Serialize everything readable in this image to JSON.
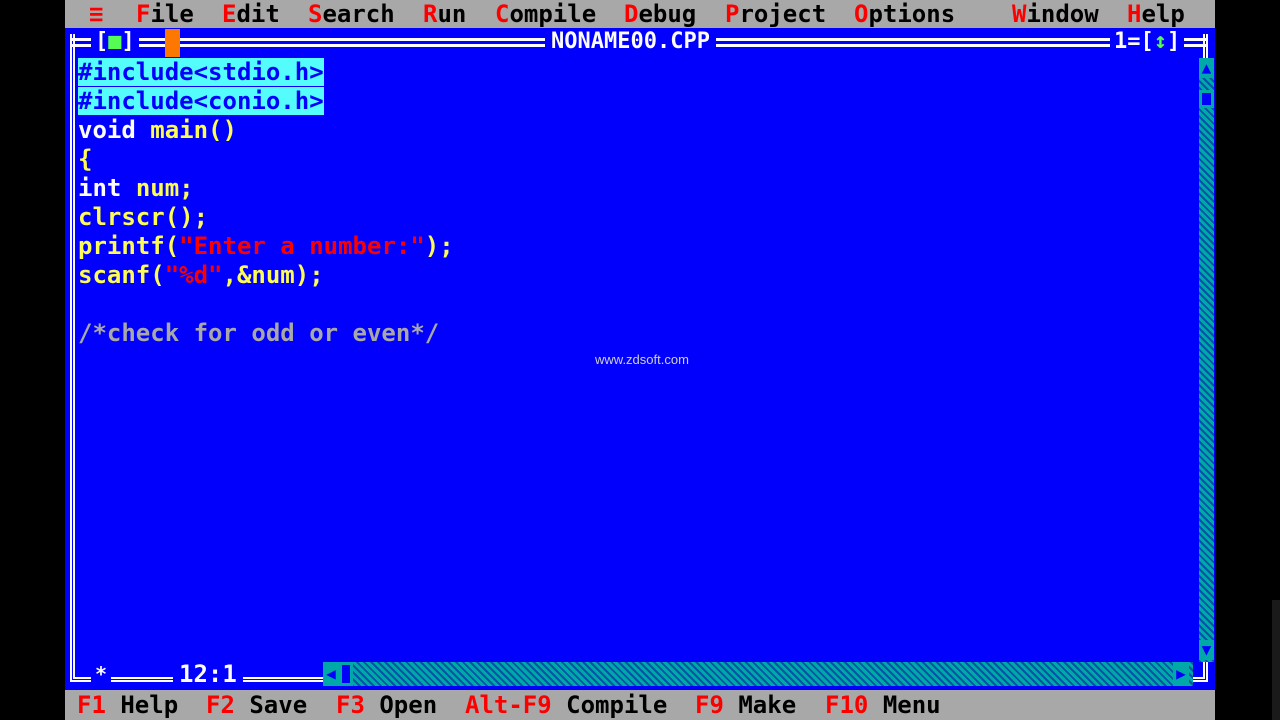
{
  "menu": {
    "system_icon": "≡",
    "items": [
      {
        "hotkey": "F",
        "rest": "ile"
      },
      {
        "hotkey": "E",
        "rest": "dit"
      },
      {
        "hotkey": "S",
        "rest": "earch"
      },
      {
        "hotkey": "R",
        "rest": "un"
      },
      {
        "hotkey": "C",
        "rest": "ompile"
      },
      {
        "hotkey": "D",
        "rest": "ebug"
      },
      {
        "hotkey": "P",
        "rest": "roject"
      },
      {
        "hotkey": "O",
        "rest": "ptions"
      },
      {
        "hotkey": "W",
        "rest": "indow"
      },
      {
        "hotkey": "H",
        "rest": "elp"
      }
    ]
  },
  "window": {
    "title": "NONAME00.CPP",
    "close_box": {
      "left": "[",
      "glyph": "■",
      "right": "]"
    },
    "zoom_box": {
      "number": "1=",
      "left": "[",
      "glyph": "↕",
      "right": "]"
    },
    "cursor_position": "12:1",
    "modified_marker": "*"
  },
  "code": {
    "include1": "#include<stdio.h>",
    "include2": "#include<conio.h>",
    "void_kw": "void",
    "main_fn": "main()",
    "open_brace": "{",
    "int_kw": "int",
    "num_decl": "num;",
    "clrscr": "clrscr();",
    "printf_fn": "printf(",
    "printf_str": "\"Enter a number:\"",
    "printf_end": ");",
    "scanf_fn": "scanf(",
    "scanf_str": "\"%d\"",
    "scanf_end": ",&num);",
    "comment": "/*check for odd or even*/"
  },
  "watermark": "www.zdsoft.com",
  "status": [
    {
      "key": "F1",
      "label": "Help"
    },
    {
      "key": "F2",
      "label": "Save"
    },
    {
      "key": "F3",
      "label": "Open"
    },
    {
      "key": "Alt-F9",
      "label": "Compile"
    },
    {
      "key": "F9",
      "label": "Make"
    },
    {
      "key": "F10",
      "label": "Menu"
    }
  ],
  "colors": {
    "editor_bg": "#0000fc",
    "menu_bg": "#a8a8a8",
    "hotkey": "#fc0000",
    "keyword": "#fcfcfc",
    "identifier": "#fcfc54",
    "string": "#fc0000",
    "selection": "#54fcfc",
    "scrollbar": "#00a8a8"
  }
}
